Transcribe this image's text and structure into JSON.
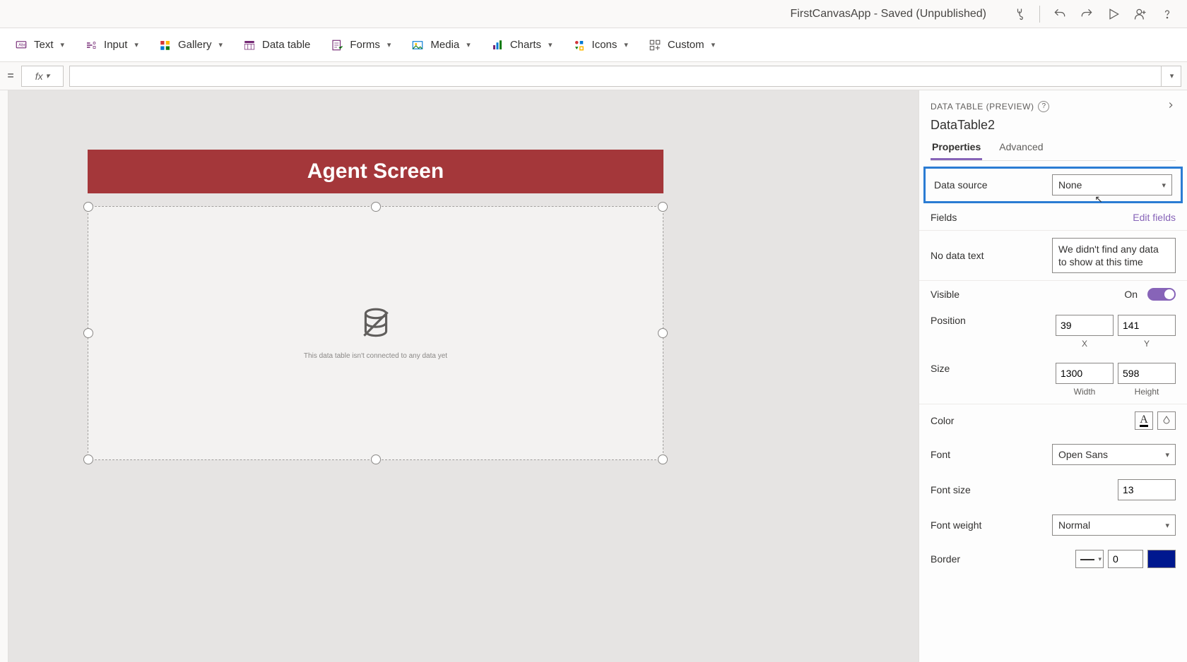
{
  "header": {
    "title": "FirstCanvasApp - Saved (Unpublished)"
  },
  "ribbon": {
    "text": "Text",
    "input": "Input",
    "gallery": "Gallery",
    "dataTable": "Data table",
    "forms": "Forms",
    "media": "Media",
    "charts": "Charts",
    "icons": "Icons",
    "custom": "Custom"
  },
  "formula": {
    "eq": "=",
    "fx": "fx",
    "value": ""
  },
  "canvas": {
    "screenTitle": "Agent Screen",
    "emptyMsg": "This data table isn't connected to any data yet"
  },
  "props": {
    "typeLabel": "DATA TABLE (PREVIEW)",
    "controlName": "DataTable2",
    "tabProperties": "Properties",
    "tabAdvanced": "Advanced",
    "dataSourceLabel": "Data source",
    "dataSourceValue": "None",
    "fieldsLabel": "Fields",
    "editFields": "Edit fields",
    "noDataLabel": "No data text",
    "noDataValue": "We didn't find any data to show at this time",
    "visibleLabel": "Visible",
    "visibleState": "On",
    "positionLabel": "Position",
    "posX": "39",
    "posY": "141",
    "xLabel": "X",
    "yLabel": "Y",
    "sizeLabel": "Size",
    "sizeW": "1300",
    "sizeH": "598",
    "wLabel": "Width",
    "hLabel": "Height",
    "colorLabel": "Color",
    "fontLabel": "Font",
    "fontValue": "Open Sans",
    "fontSizeLabel": "Font size",
    "fontSizeValue": "13",
    "fontWeightLabel": "Font weight",
    "fontWeightValue": "Normal",
    "borderLabel": "Border",
    "borderValue": "0"
  }
}
